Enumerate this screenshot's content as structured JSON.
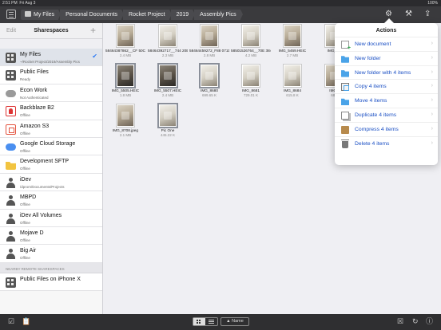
{
  "status": {
    "time": "2:51 PM",
    "date": "Fri Aug 3",
    "battery": "100%"
  },
  "breadcrumbs": [
    "My Files",
    "Personal Documents",
    "Rocket Project",
    "2019",
    "Assembly Pics"
  ],
  "sidebar": {
    "edit_label": "Edit",
    "title": "Sharespaces",
    "add_label": "+",
    "items": [
      {
        "name": "My Files",
        "sub": "~/Rocket Project/2019/Assembly Pics",
        "icon": "grid",
        "selected": true
      },
      {
        "name": "Public Files",
        "sub": "Ready",
        "icon": "grid"
      },
      {
        "name": "Econ Work",
        "sub": "Not Authenticated",
        "icon": "cloud"
      },
      {
        "name": "Backblaze B2",
        "sub": "Offline",
        "icon": "bb"
      },
      {
        "name": "Amazon S3",
        "sub": "Offline",
        "icon": "s3"
      },
      {
        "name": "Google Cloud Storage",
        "sub": "Offline",
        "icon": "gcs"
      },
      {
        "name": "Development SFTP",
        "sub": "Offline",
        "icon": "sftp"
      },
      {
        "name": "iDev",
        "sub": "/dprom/Documents/Projects",
        "icon": "idev"
      },
      {
        "name": "MBPD",
        "sub": "Offline",
        "icon": "idev"
      },
      {
        "name": "iDev All Volumes",
        "sub": "Offline",
        "icon": "idev"
      },
      {
        "name": "Mojave D",
        "sub": "Offline",
        "icon": "idev"
      },
      {
        "name": "Big Air",
        "sub": "Offline",
        "icon": "idev"
      }
    ],
    "nearby_header": "NEARBY REMOTE SHARESPACES",
    "nearby_items": [
      {
        "name": "Public Files on iPhone X",
        "sub": "",
        "icon": "grid"
      }
    ]
  },
  "files": [
    {
      "name": "58464387862__CF 50C6861-...001.JPG",
      "size": "2.4 MB",
      "tone": "normal"
    },
    {
      "name": "58464392717__744 20E05-2...E05.JPG",
      "size": "2.3 MB",
      "tone": "light"
    },
    {
      "name": "58464459272_F88 071D3-0...254.JPG",
      "size": "2.8 MB",
      "tone": "normal"
    },
    {
      "name": "58501526764__70E 38431-5...F151.JPG",
      "size": "4.2 MB",
      "tone": "light"
    },
    {
      "name": "IMG_5469.HEIC",
      "size": "2.7 MB",
      "tone": "normal"
    },
    {
      "name": "IMG_54",
      "size": "",
      "tone": "light"
    },
    {
      "name": "IMG_5505.HEIC",
      "size": "1.8 MB",
      "tone": "dark",
      "selected": true
    },
    {
      "name": "IMG_5507.HEIC",
      "size": "2.4 MB",
      "tone": "dark",
      "selected": true
    },
    {
      "name": "IMG_8680",
      "size": "699.65 K",
      "tone": "light",
      "selected": true
    },
    {
      "name": "IMG_8681",
      "size": "729.01 K",
      "tone": "light"
    },
    {
      "name": "IMG_8684",
      "size": "615.8 K",
      "tone": "light"
    },
    {
      "name": "IMG_",
      "size": "683",
      "tone": "normal"
    },
    {
      "name": "IMG_8708.jpeg",
      "size": "2.1 MB",
      "tone": "normal"
    },
    {
      "name": "Pic One",
      "size": "445.22 K",
      "tone": "light",
      "selected": true
    }
  ],
  "actions": {
    "title": "Actions",
    "items": [
      {
        "label": "New document",
        "icon": "doc"
      },
      {
        "label": "New folder",
        "icon": "folder"
      },
      {
        "label": "New folder with 4 items",
        "icon": "folder2"
      },
      {
        "label": "Copy 4 items",
        "icon": "copy"
      },
      {
        "label": "Move 4 items",
        "icon": "move"
      },
      {
        "label": "Duplicate 4 items",
        "icon": "dup"
      },
      {
        "label": "Compress 4 items",
        "icon": "zip"
      },
      {
        "label": "Delete 4 items",
        "icon": "trash"
      }
    ]
  },
  "bottom": {
    "sort_label": "▲ Name"
  }
}
